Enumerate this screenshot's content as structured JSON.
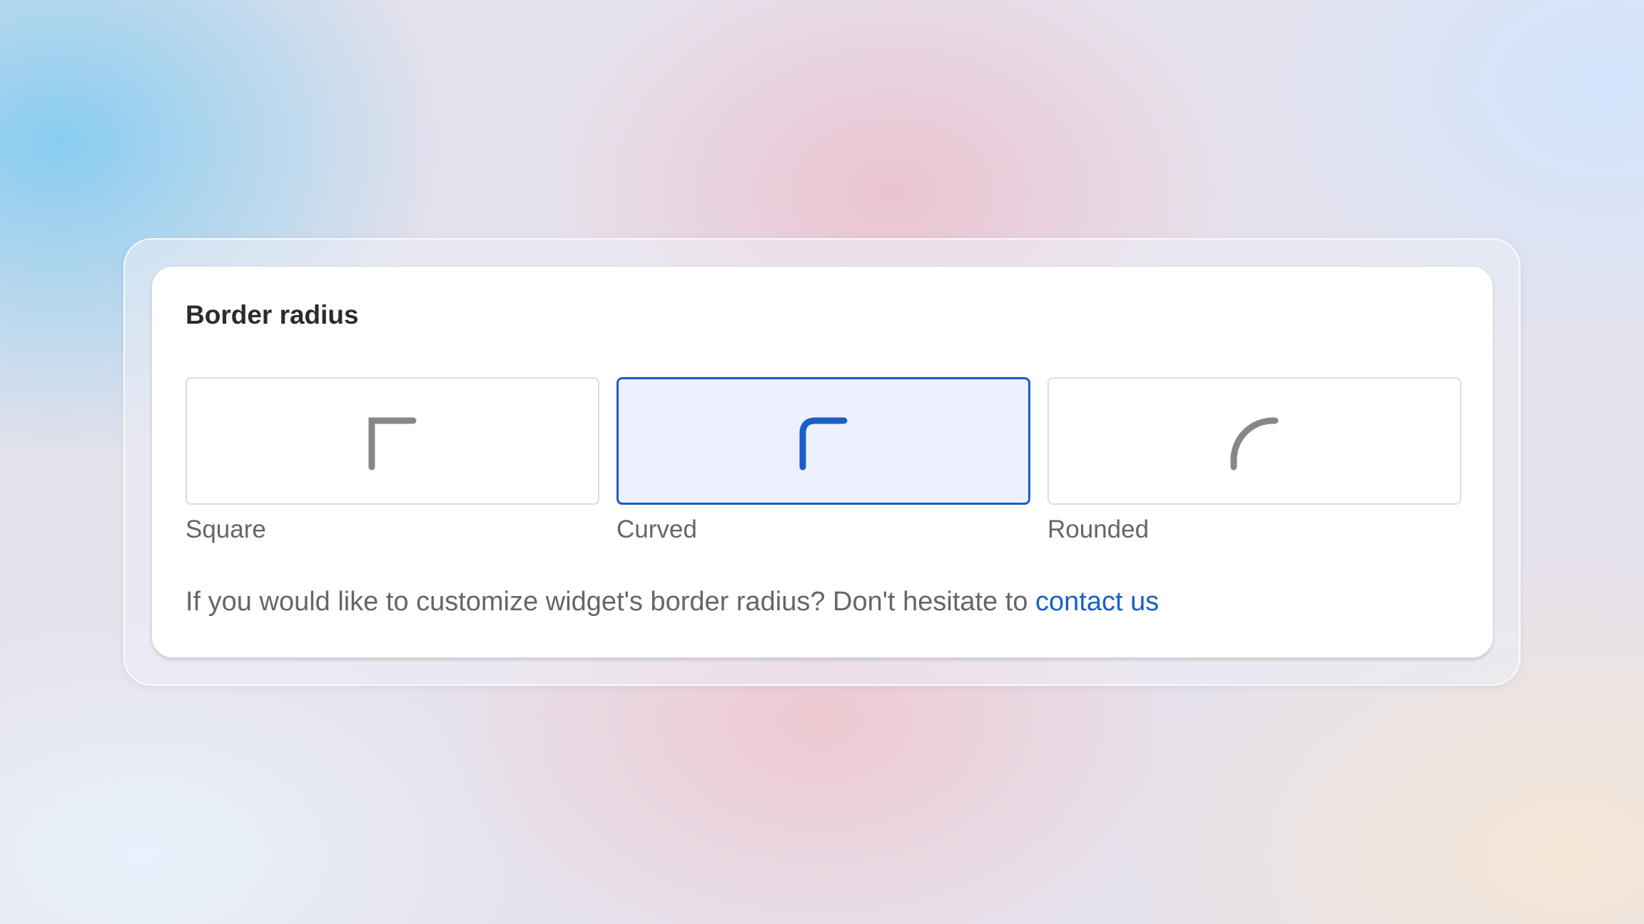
{
  "panel": {
    "title": "Border radius",
    "options": [
      {
        "label": "Square",
        "icon": "square-corner-icon",
        "selected": false
      },
      {
        "label": "Curved",
        "icon": "curved-corner-icon",
        "selected": true
      },
      {
        "label": "Rounded",
        "icon": "rounded-corner-icon",
        "selected": false
      }
    ],
    "help_text": "If you would like to customize widget's border radius? Don't hesitate to ",
    "help_link": "contact us"
  },
  "colors": {
    "accent": "#1a5fc6",
    "selected_background": "#edf1fd",
    "icon_default": "#878787",
    "text_muted": "#666666",
    "title_text": "#2b2b2b"
  }
}
